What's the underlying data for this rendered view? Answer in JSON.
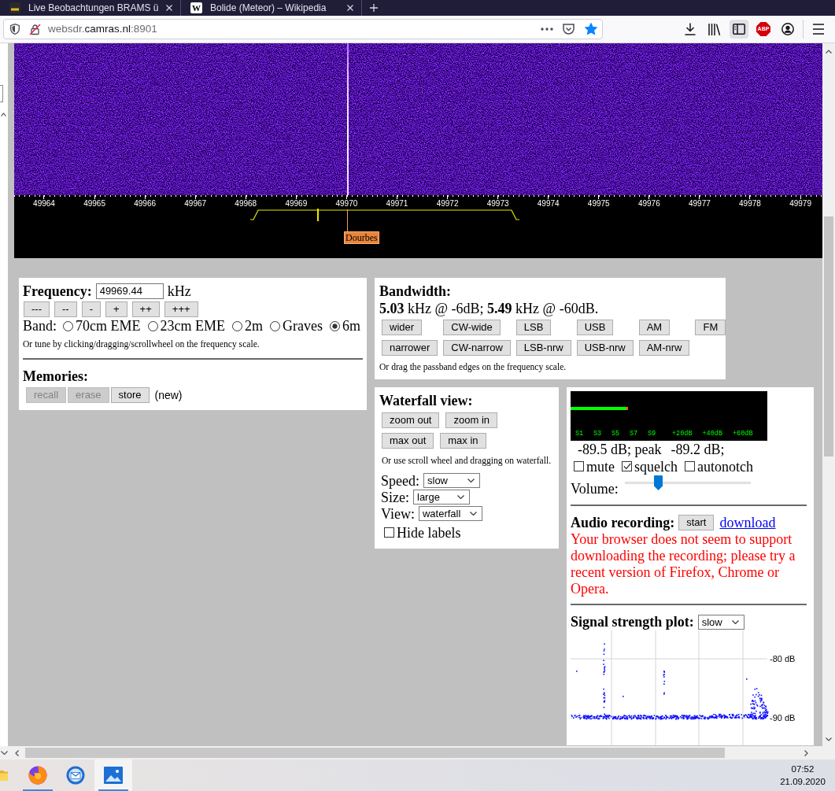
{
  "browser": {
    "tabs": [
      {
        "title": "Live Beobachtungen BRAMS ü"
      },
      {
        "title": "Bolide (Meteor) – Wikipedia",
        "favicon_letter": "W"
      }
    ],
    "address": {
      "subdomain": "websdr.",
      "domain": "camras.nl",
      "port": ":8901"
    },
    "bookmarked": true,
    "sidebar_open": true,
    "extension_badge": "ABP"
  },
  "frequency_scale": {
    "labels": [
      "49964",
      "49965",
      "49966",
      "49967",
      "49968",
      "49969",
      "49970",
      "49971",
      "49972",
      "49973",
      "49974",
      "49975",
      "49976",
      "49977",
      "49978",
      "49979"
    ],
    "station": "Dourbes"
  },
  "frequency": {
    "title": "Frequency:",
    "value": "49969.44",
    "unit": "kHz",
    "step_buttons": [
      "---",
      "--",
      "-",
      "+",
      "++",
      "+++"
    ],
    "band_label": "Band:",
    "bands": [
      {
        "label": "70cm EME",
        "selected": false
      },
      {
        "label": "23cm EME",
        "selected": false
      },
      {
        "label": "2m",
        "selected": false
      },
      {
        "label": "Graves",
        "selected": false
      },
      {
        "label": "6m",
        "selected": true
      }
    ],
    "hint": "Or tune by clicking/dragging/scrollwheel on the frequency scale."
  },
  "memories": {
    "title": "Memories:",
    "buttons": [
      {
        "label": "recall",
        "disabled": true
      },
      {
        "label": "erase",
        "disabled": true
      },
      {
        "label": "store",
        "disabled": false
      }
    ],
    "status": "(new)"
  },
  "bandwidth": {
    "title": "Bandwidth:",
    "summary": "**5.03** kHz @ -6dB; **5.49** kHz @ -60dB.",
    "button_rows": [
      [
        "wider",
        "CW-wide",
        "LSB",
        "USB",
        "AM",
        "FM"
      ],
      [
        "narrower",
        "CW-narrow",
        "LSB-nrw",
        "USB-nrw",
        "AM-nrw"
      ]
    ],
    "hint": "Or drag the passband edges on the frequency scale."
  },
  "waterfall_view": {
    "title": "Waterfall view:",
    "button_rows": [
      [
        "zoom out",
        "zoom in"
      ],
      [
        "max out",
        "max in"
      ]
    ],
    "hint": "Or use scroll wheel and dragging on waterfall.",
    "settings": [
      {
        "label": "Speed:",
        "value": "slow"
      },
      {
        "label": "Size:",
        "value": "large"
      },
      {
        "label": "View:",
        "value": "waterfall"
      }
    ],
    "hide_labels": {
      "label": "Hide labels",
      "checked": false
    }
  },
  "audio": {
    "s_meter": {
      "level": 0.29,
      "scale": [
        "S1",
        "S3",
        "S5",
        "S7",
        "S9",
        "+20dB",
        "+40dB",
        "+60dB"
      ]
    },
    "reading": "-89.5 dB; peak",
    "peak": "-89.2 dB;",
    "options": [
      {
        "label": "mute",
        "checked": false
      },
      {
        "label": "squelch",
        "checked": true
      },
      {
        "label": "autonotch",
        "checked": false
      }
    ],
    "volume": {
      "label": "Volume:",
      "level": 0.25
    }
  },
  "recording": {
    "title": "Audio recording:",
    "button": "start",
    "link": "download",
    "message": "Your browser does not seem to support downloading the recording; please try a recent version of Firefox, Chrome or Opera."
  },
  "signal_plot": {
    "title": "Signal strength plot:",
    "speed": "slow",
    "y_labels": [
      "-80 dB",
      "-90 dB"
    ]
  },
  "taskbar": {
    "apps": [
      {
        "kind": "folder",
        "running": false,
        "selected": false
      },
      {
        "kind": "browser",
        "running": true,
        "selected": false
      },
      {
        "kind": "mail",
        "running": false,
        "selected": false
      },
      {
        "kind": "photos",
        "running": true,
        "selected": true
      }
    ],
    "time": "07:52",
    "date": "21.09.2020"
  }
}
